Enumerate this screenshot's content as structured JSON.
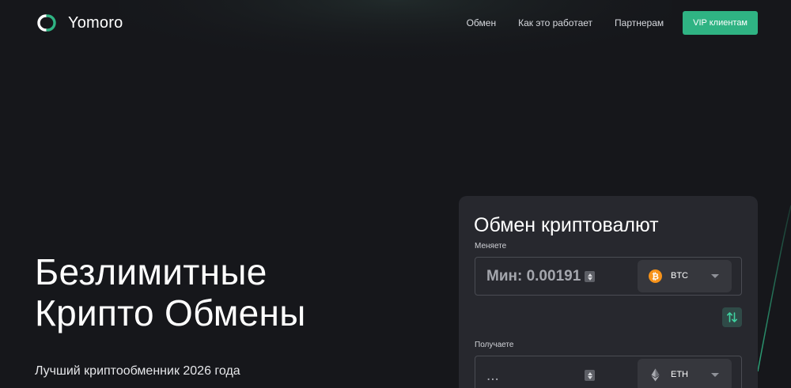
{
  "brand": {
    "name": "Yomoro",
    "logo_icon": "yomoro-logo-icon",
    "accent_color": "#2fb383"
  },
  "nav": {
    "items": [
      {
        "label": "Обмен"
      },
      {
        "label": "Как это работает"
      },
      {
        "label": "Партнерам"
      }
    ],
    "vip_button": "VIP клиентам"
  },
  "hero": {
    "title_line1": "Безлимитные",
    "title_line2": "Крипто Обмены",
    "subtitle": "Лучший криптообменник 2026 года"
  },
  "exchange": {
    "title": "Обмен криптовалют",
    "send": {
      "label": "Меняете",
      "value": "Мин: 0.00191",
      "currency": "BTC",
      "currency_icon": "bitcoin-icon",
      "currency_color": "#f7931a"
    },
    "swap_icon": "swap-arrows-icon",
    "receive": {
      "label": "Получаете",
      "value": "...",
      "currency": "ETH",
      "currency_icon": "ethereum-icon"
    }
  }
}
